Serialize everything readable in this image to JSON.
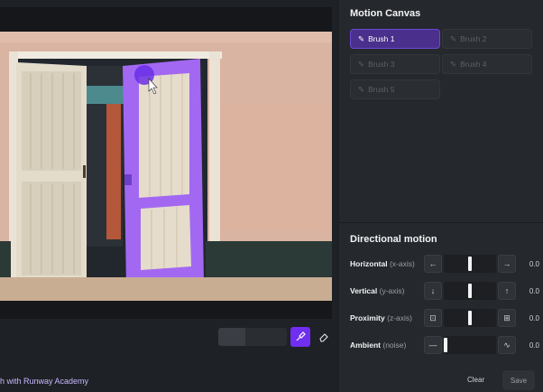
{
  "canvas": {
    "image_desc_icon": "door-scene-image",
    "cursor": "hand-pointer-icon"
  },
  "toolbar": {
    "brush_icon": "brush-icon",
    "eraser_icon": "eraser-icon"
  },
  "academy_link": "h with Runway Academy",
  "panel": {
    "motion_title": "Motion Canvas",
    "brushes": [
      {
        "label": "Brush 1",
        "active": true
      },
      {
        "label": "Brush 2",
        "active": false
      },
      {
        "label": "Brush 3",
        "active": false
      },
      {
        "label": "Brush 4",
        "active": false
      },
      {
        "label": "Brush 5",
        "active": false
      }
    ],
    "directional_title": "Directional motion",
    "controls": [
      {
        "label": "Horizontal",
        "axis": "(x-axis)",
        "value": "0.0",
        "left_icon": "arrow-left-icon",
        "right_icon": "arrow-right-icon",
        "left_glyph": "←",
        "right_glyph": "→",
        "level": 0.5
      },
      {
        "label": "Vertical",
        "axis": "(y-axis)",
        "value": "0.0",
        "left_icon": "arrow-down-icon",
        "right_icon": "arrow-up-icon",
        "left_glyph": "↓",
        "right_glyph": "↑",
        "level": 0.5
      },
      {
        "label": "Proximity",
        "axis": "(z-axis)",
        "value": "0.0",
        "left_icon": "zoom-out-icon",
        "right_icon": "zoom-in-icon",
        "left_glyph": "⊡",
        "right_glyph": "⊞",
        "level": 0.5
      },
      {
        "label": "Ambient",
        "axis": "(noise)",
        "value": "0.0",
        "left_icon": "flat-line-icon",
        "right_icon": "wave-icon",
        "left_glyph": "—",
        "right_glyph": "∿",
        "level": 0.0
      }
    ],
    "clear_label": "Clear",
    "save_label": "Save"
  },
  "colors": {
    "accent": "#6f2ef0",
    "brush_active": "#4a2f8c",
    "paint": "#a268f2"
  }
}
